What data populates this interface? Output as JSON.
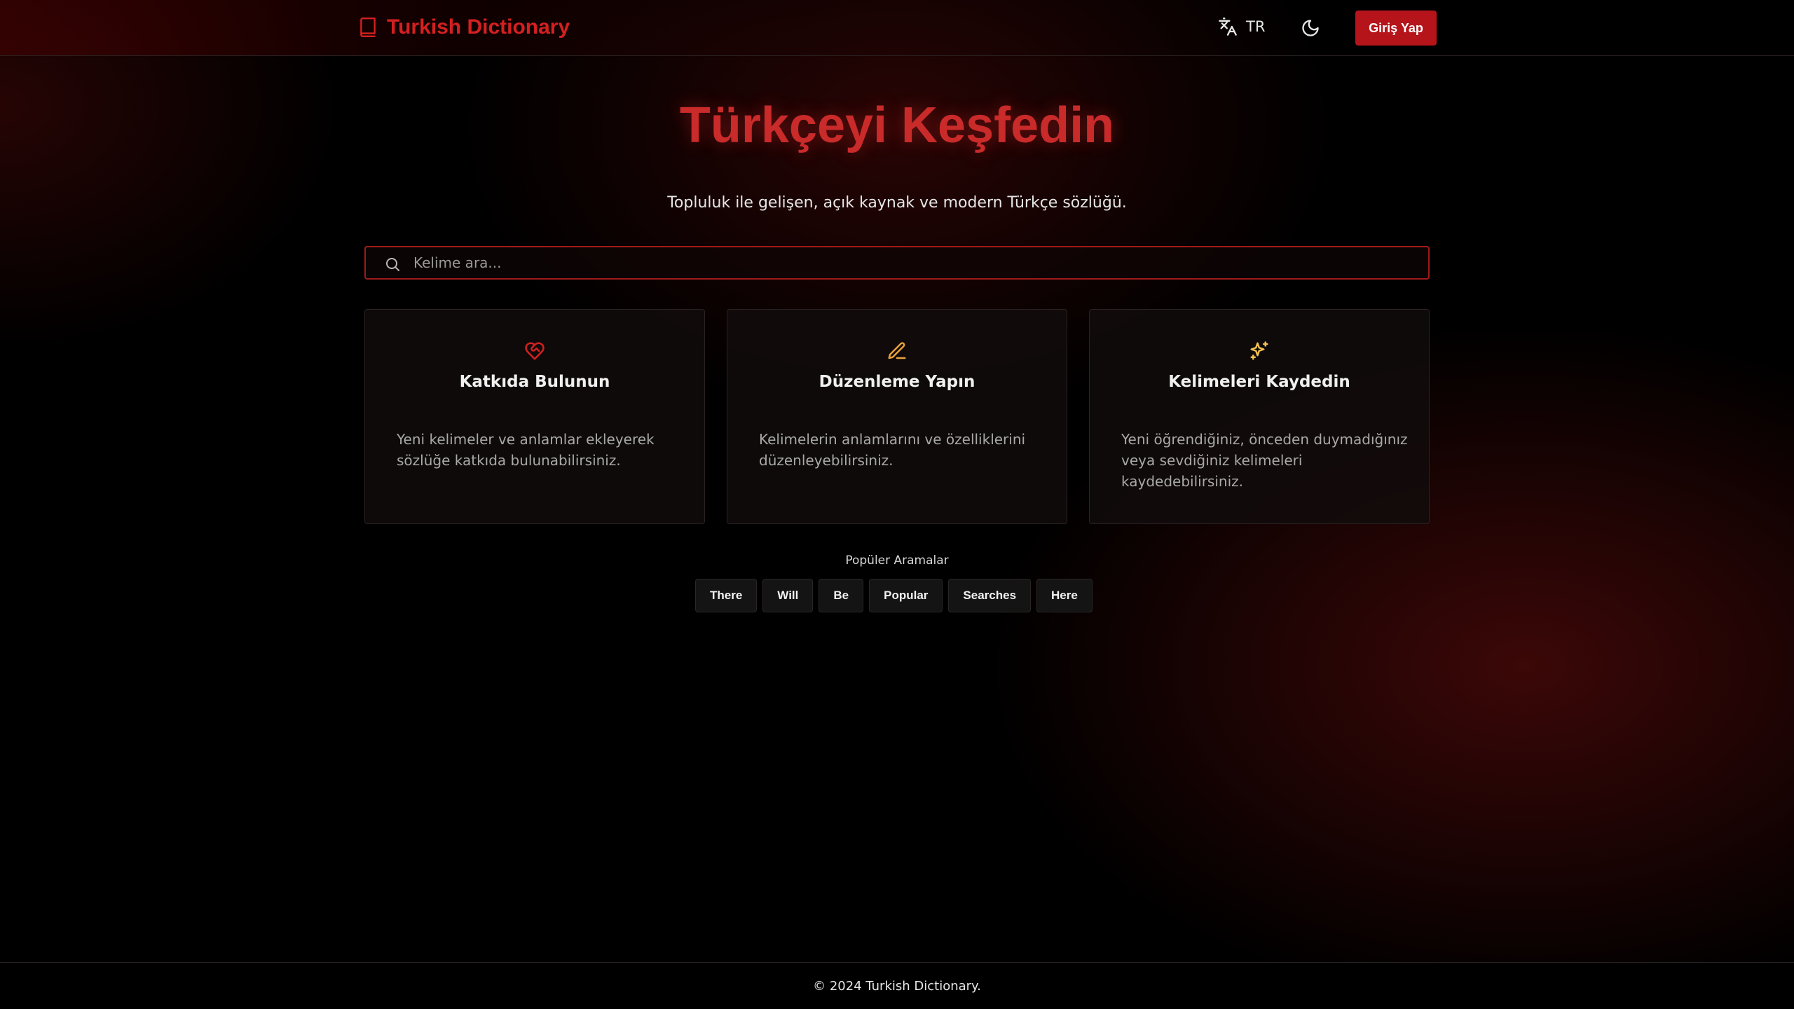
{
  "header": {
    "brand_title": "Turkish Dictionary",
    "language_label": "TR",
    "login_label": "Giriş Yap"
  },
  "hero": {
    "title": "Türkçeyi Keşfedin",
    "subtitle": "Topluluk ile gelişen, açık kaynak ve modern Türkçe sözlüğü."
  },
  "search": {
    "placeholder": "Kelime ara..."
  },
  "cards": [
    {
      "icon": "heart-handshake-icon",
      "title": "Katkıda Bulunun",
      "description": "Yeni kelimeler ve anlamlar ekleyerek sözlüğe katkıda bulunabilirsiniz."
    },
    {
      "icon": "pencil-icon",
      "title": "Düzenleme Yapın",
      "description": "Kelimelerin anlamlarını ve özelliklerini düzenleyebilirsiniz."
    },
    {
      "icon": "sparkles-icon",
      "title": "Kelimeleri Kaydedin",
      "description": "Yeni öğrendiğiniz, önceden duymadığınız veya sevdiğiniz kelimeleri kaydedebilirsiniz."
    }
  ],
  "popular": {
    "label": "Popüler Aramalar",
    "items": [
      "There",
      "Will",
      "Be",
      "Popular",
      "Searches",
      "Here"
    ]
  },
  "footer": {
    "copyright": "© 2024 Turkish Dictionary."
  },
  "colors": {
    "accent": "#c92a2a",
    "button": "#b5141a",
    "icon_orange": "#e8a13a",
    "icon_yellow": "#f2c14e"
  }
}
